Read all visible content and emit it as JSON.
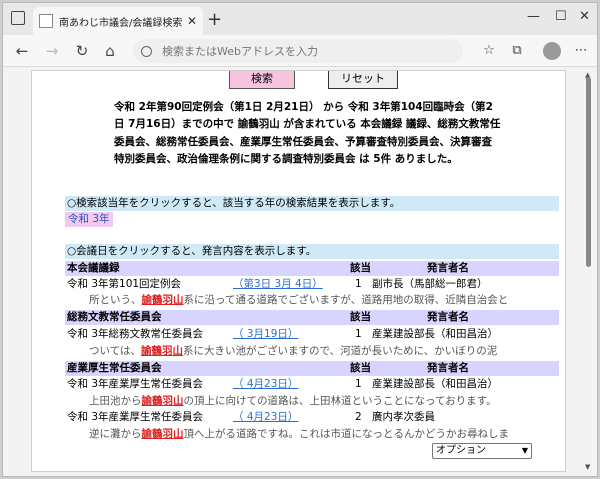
{
  "browser": {
    "tab_title": "南あわじ市議会/会議録検索システ",
    "address_placeholder": "検索またはWebアドレスを入力"
  },
  "buttons": {
    "search": "検索",
    "reset": "リセット"
  },
  "summary": "令和 2年第90回定例会（第1日 2月21日） から 令和 3年第104回臨時会（第2日 7月16日）までの中で 諭鶴羽山 が含まれている 本会議録 議録、総務文教常任委員会、総務常任委員会、産業厚生常任委員会、予算審査特別委員会、決算審査特別委員会、政治倫理条例に関する調査特別委員会 は 5件 ありました。",
  "year_section": {
    "instruction": "○検索該当年をクリックすると、該当する年の検索結果を表示します。",
    "year": "令和 3年"
  },
  "day_section": {
    "instruction": "○会議日をクリックすると、発言内容を表示します。"
  },
  "col_labels": {
    "hit": "該当",
    "speaker": "発言者名"
  },
  "keyword": "諭鶴羽山",
  "groups": [
    {
      "name": "本会議議録",
      "rows": [
        {
          "meeting": "令和 3年第101回定例会",
          "date": "（第3日 3月 4日）",
          "count": "1",
          "speaker": "副市長（馬部総一郎君）",
          "snip_before": "所という、",
          "snip_after": "系に沿って通る道路でございますが、道路用地の取得、近隣自治会と"
        }
      ]
    },
    {
      "name": "総務文教常任委員会",
      "rows": [
        {
          "meeting": "令和 3年総務文教常任委員会",
          "date": "（ 3月19日）",
          "count": "1",
          "speaker": "産業建設部長（和田昌治）",
          "snip_before": "ついては、",
          "snip_after": "系に大きい池がございますので、河道が長いために、かいぼりの泥"
        }
      ]
    },
    {
      "name": "産業厚生常任委員会",
      "rows": [
        {
          "meeting": "令和 3年産業厚生常任委員会",
          "date": "（ 4月23日）",
          "count": "1",
          "speaker": "産業建設部長（和田昌治）",
          "snip_before": "上田池から",
          "snip_after": "の頂上に向けての道路は、上田林道ということになっております。"
        },
        {
          "meeting": "令和 3年産業厚生常任委員会",
          "date": "（ 4月23日）",
          "count": "2",
          "speaker": "廣内孝次委員",
          "snip_before": "逆に灘から",
          "snip_after": "頂へ上がる道路ですね。これは市道になっとるんかどうかお尋ねしま"
        }
      ]
    }
  ],
  "option_select": "オプション"
}
